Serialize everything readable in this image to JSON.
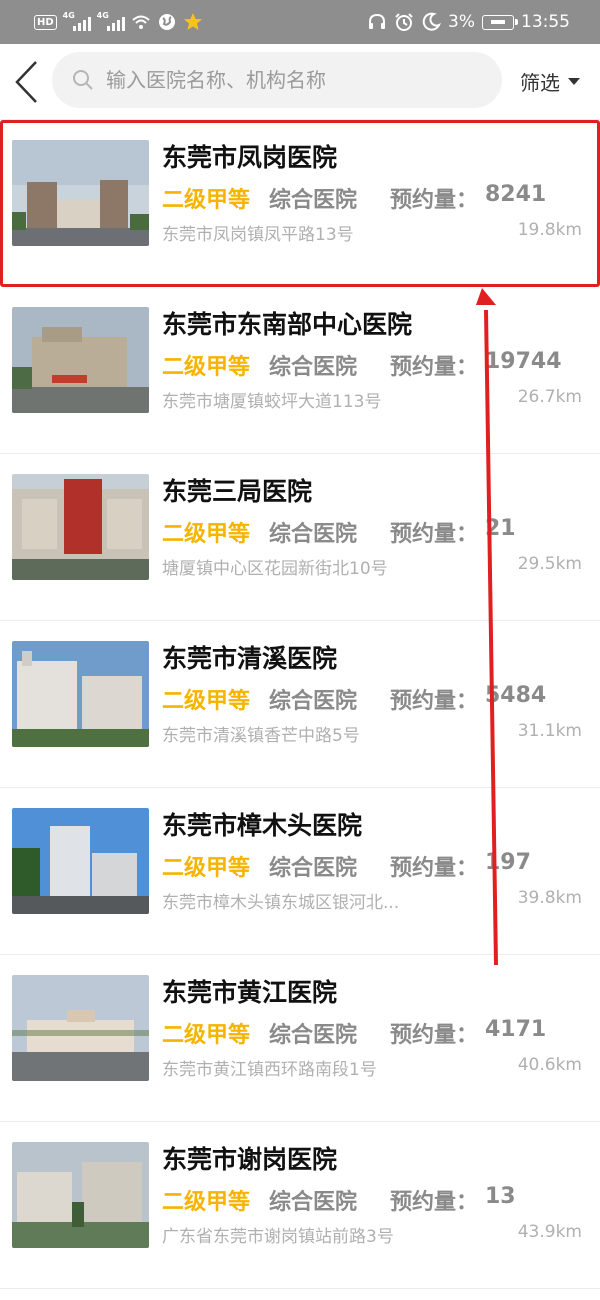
{
  "status_bar": {
    "hd_label": "HD",
    "net1_label": "4G",
    "net2_label": "4G",
    "battery_percent": "3%",
    "time": "13:55"
  },
  "header": {
    "search_placeholder": "输入医院名称、机构名称",
    "filter_label": "筛选"
  },
  "hospitals": [
    {
      "name": "东莞市凤岗医院",
      "grade": "二级甲等",
      "type": "综合医院",
      "volume_label": "预约量：",
      "volume": "8241",
      "address": "东莞市凤岗镇凤平路13号",
      "distance": "19.8km",
      "highlighted": true
    },
    {
      "name": "东莞市东南部中心医院",
      "grade": "二级甲等",
      "type": "综合医院",
      "volume_label": "预约量：",
      "volume": "19744",
      "address": "东莞市塘厦镇蛟坪大道113号",
      "distance": "26.7km",
      "highlighted": false
    },
    {
      "name": "东莞三局医院",
      "grade": "二级甲等",
      "type": "综合医院",
      "volume_label": "预约量：",
      "volume": "21",
      "address": "塘厦镇中心区花园新街北10号",
      "distance": "29.5km",
      "highlighted": false
    },
    {
      "name": "东莞市清溪医院",
      "grade": "二级甲等",
      "type": "综合医院",
      "volume_label": "预约量：",
      "volume": "5484",
      "address": "东莞市清溪镇香芒中路5号",
      "distance": "31.1km",
      "highlighted": false
    },
    {
      "name": "东莞市樟木头医院",
      "grade": "二级甲等",
      "type": "综合医院",
      "volume_label": "预约量：",
      "volume": "197",
      "address": "东莞市樟木头镇东城区银河北...",
      "distance": "39.8km",
      "highlighted": false
    },
    {
      "name": "东莞市黄江医院",
      "grade": "二级甲等",
      "type": "综合医院",
      "volume_label": "预约量：",
      "volume": "4171",
      "address": "东莞市黄江镇西环路南段1号",
      "distance": "40.6km",
      "highlighted": false
    },
    {
      "name": "东莞市谢岗医院",
      "grade": "二级甲等",
      "type": "综合医院",
      "volume_label": "预约量：",
      "volume": "13",
      "address": "广东省东莞市谢岗镇站前路3号",
      "distance": "43.9km",
      "highlighted": false
    }
  ],
  "colors": {
    "grade": "#f6b400",
    "highlight_border": "#e02020",
    "annotation_arrow": "#e02020",
    "status_bar_bg": "#8e8e8e"
  },
  "icons": {
    "back": "chevron-left-icon",
    "search": "search-icon",
    "filter_caret": "caret-down-icon"
  }
}
